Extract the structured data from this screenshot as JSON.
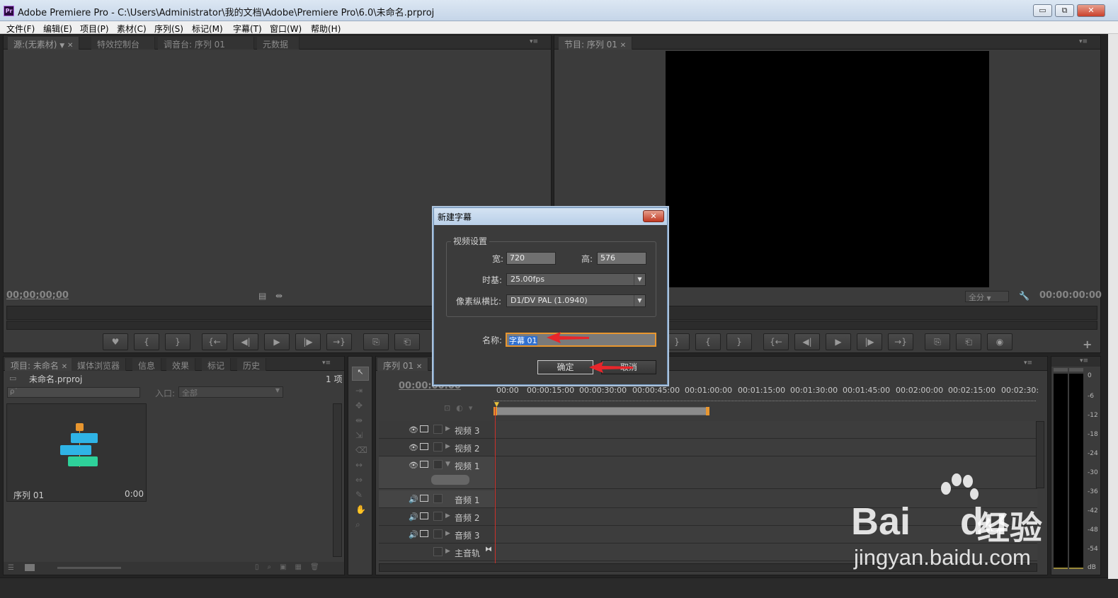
{
  "window": {
    "app_icon": "Pr",
    "title": "Adobe Premiere Pro - C:\\Users\\Administrator\\我的文档\\Adobe\\Premiere Pro\\6.0\\未命名.prproj",
    "minimize_icon": "▭",
    "restore_icon": "⧉",
    "close_icon": "✕"
  },
  "menu": [
    "文件(F)",
    "编辑(E)",
    "项目(P)",
    "素材(C)",
    "序列(S)",
    "标记(M)",
    "字幕(T)",
    "窗口(W)",
    "帮助(H)"
  ],
  "source_panel": {
    "tabs": [
      "源:(无素材)",
      "特效控制台",
      "调音台: 序列 01",
      "元数据"
    ],
    "timecode": "00;00;00;00"
  },
  "program_panel": {
    "tab": "节目: 序列 01",
    "zoom": "全分",
    "timecode": "00:00:00:00"
  },
  "transport_icons": [
    "♥",
    "{",
    "}",
    "{←",
    "◀|",
    "▶",
    "|▶",
    "→}",
    "⎘",
    "⎗"
  ],
  "program_transport_icons": [
    "}",
    "{",
    "}",
    "{←",
    "◀|",
    "▶",
    "|▶",
    "→}",
    "⎘",
    "⎗",
    "◉"
  ],
  "project_panel": {
    "tabs": [
      "项目: 未命名",
      "媒体浏览器",
      "信息",
      "效果",
      "标记",
      "历史"
    ],
    "project_name": "未命名.prproj",
    "item_count": "1 项",
    "search_placeholder": "ρ˙",
    "in_label": "入口:",
    "in_value": "全部",
    "item_name": "序列 01",
    "item_duration": "0:00"
  },
  "timeline_panel": {
    "tab": "序列 01",
    "timecode": "00:00:00:00",
    "ruler": [
      "00:00",
      "00:00:15:00",
      "00:00:30:00",
      "00:00:45:00",
      "00:01:00:00",
      "00:01:15:00",
      "00:01:30:00",
      "00:01:45:00",
      "00:02:00:00",
      "00:02:15:00",
      "00:02:30:"
    ],
    "tracks": [
      {
        "name": "视频 3",
        "kind": "video"
      },
      {
        "name": "视频 2",
        "kind": "video"
      },
      {
        "name": "视频 1",
        "kind": "video"
      },
      {
        "name": "音频 1",
        "kind": "audio"
      },
      {
        "name": "音频 2",
        "kind": "audio"
      },
      {
        "name": "音频 3",
        "kind": "audio"
      },
      {
        "name": "主音轨",
        "kind": "master"
      }
    ]
  },
  "audio_meter": {
    "labels": [
      "0",
      "-6",
      "-12",
      "-18",
      "-24",
      "-30",
      "-36",
      "-42",
      "-48",
      "-54",
      "dB"
    ]
  },
  "dialog": {
    "title": "新建字幕",
    "group_label": "视频设置",
    "width_label": "宽:",
    "width_value": "720",
    "height_label": "高:",
    "height_value": "576",
    "timebase_label": "时基:",
    "timebase_value": "25.00fps",
    "par_label": "像素纵横比:",
    "par_value": "D1/DV PAL (1.0940)",
    "name_label": "名称:",
    "name_value": "字幕 01",
    "ok_label": "确定",
    "cancel_label": "取消"
  },
  "watermark": {
    "brand": "Bai",
    "brand2": "du",
    "service": "经验",
    "url": "jingyan.baidu.com"
  },
  "colors": {
    "panel_bg": "#3b3b3b",
    "timeline_playhead": "#c8302a",
    "annotation_arrow": "#e8262b",
    "sequence_icon_blue": "#2fb4e6",
    "sequence_icon_green": "#2ed19a",
    "work_area_orange": "#e8962f"
  }
}
